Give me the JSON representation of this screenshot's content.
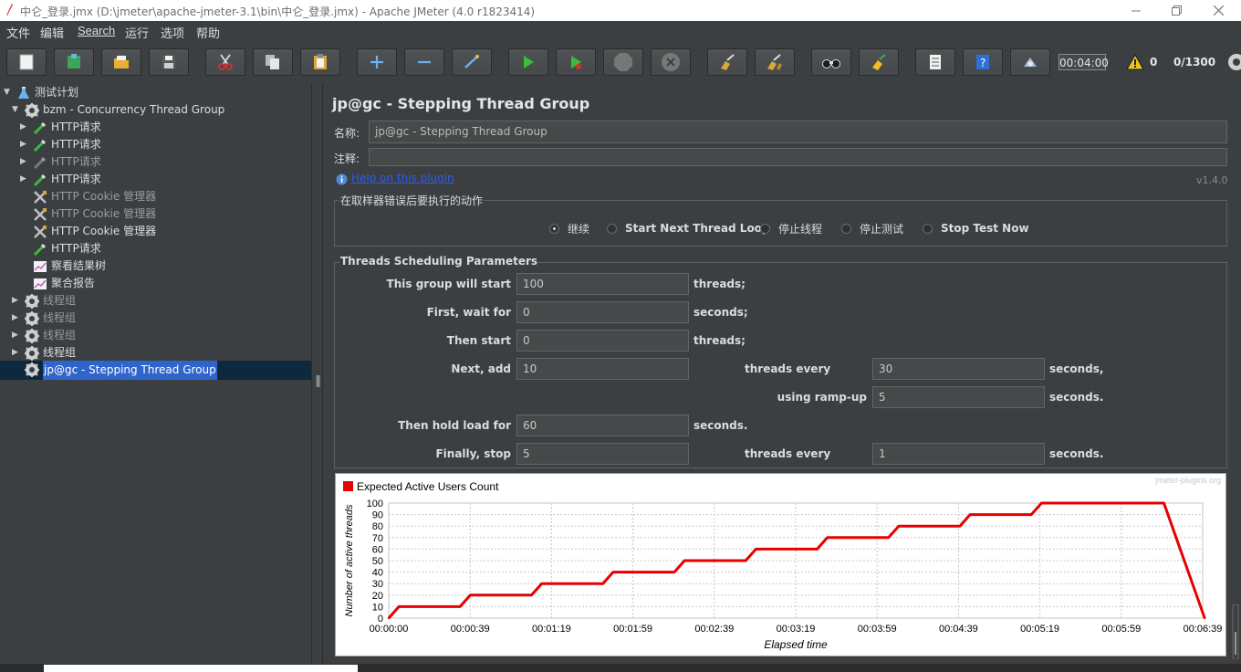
{
  "window": {
    "title": "中仑_登录.jmx (D:\\jmeter\\apache-jmeter-3.1\\bin\\中仑_登录.jmx) - Apache JMeter (4.0 r1823414)"
  },
  "menu": [
    "文件",
    "编辑",
    "Search",
    "运行",
    "选项",
    "帮助"
  ],
  "toolbar": {
    "timer": "00:04:00",
    "warnings": "0",
    "threads": "0/1300",
    "buttons": [
      "new-icon",
      "templates-icon",
      "open-icon",
      "save-icon",
      "cut-icon",
      "copy-icon",
      "paste-icon",
      "expand-icon",
      "collapse-icon",
      "toggle-icon",
      "start-icon",
      "start-no-pause-icon",
      "stop-icon",
      "shutdown-icon",
      "clear-icon",
      "clear-all-icon",
      "search-icon",
      "reset-search-icon",
      "function-helper-icon",
      "help-icon",
      "remote-icon"
    ]
  },
  "tree": {
    "items": [
      {
        "label": "测试计划"
      },
      {
        "label": "bzm - Concurrency Thread Group"
      },
      {
        "label": "HTTP请求"
      },
      {
        "label": "HTTP请求"
      },
      {
        "label": "HTTP请求"
      },
      {
        "label": "HTTP请求"
      },
      {
        "label": "HTTP Cookie 管理器"
      },
      {
        "label": "HTTP Cookie 管理器"
      },
      {
        "label": "HTTP Cookie 管理器"
      },
      {
        "label": "HTTP请求"
      },
      {
        "label": "察看结果树"
      },
      {
        "label": "聚合报告"
      },
      {
        "label": "线程组"
      },
      {
        "label": "线程组"
      },
      {
        "label": "线程组"
      },
      {
        "label": "线程组"
      },
      {
        "label": "jp@gc - Stepping Thread Group"
      }
    ]
  },
  "panel": {
    "title": "jp@gc - Stepping Thread Group",
    "name_label": "名称:",
    "name_value": "jp@gc - Stepping Thread Group",
    "comment_label": "注释:",
    "comment_value": "",
    "help_link": "Help on this plugin",
    "version": "v1.4.0",
    "error_group_title": "在取样器错误后要执行的动作",
    "error_options": [
      "继续",
      "Start Next Thread Loop",
      "停止线程",
      "停止测试",
      "Stop Test Now"
    ],
    "error_selected": "继续",
    "sched_title": "Threads Scheduling Parameters",
    "sched": {
      "start_label": "This group will start",
      "start_value": "100",
      "start_unit": "threads;",
      "wait_label": "First, wait for",
      "wait_value": "0",
      "wait_unit": "seconds;",
      "then_label": "Then start",
      "then_value": "0",
      "then_unit": "threads;",
      "next_label": "Next, add",
      "next_value": "10",
      "next_mid": "threads every",
      "next_value2": "30",
      "next_unit": "seconds,",
      "ramp_label": "using ramp-up",
      "ramp_value": "5",
      "ramp_unit": "seconds.",
      "hold_label": "Then hold load for",
      "hold_value": "60",
      "hold_unit": "seconds.",
      "stop_label": "Finally, stop",
      "stop_value": "5",
      "stop_mid": "threads every",
      "stop_value2": "1",
      "stop_unit": "seconds."
    }
  },
  "chart_data": {
    "type": "line",
    "legend": "Expected Active Users Count",
    "watermark": "jmeter-plugins.org",
    "xlabel": "Elapsed time",
    "ylabel": "Number of active threads",
    "xlim": [
      0,
      399
    ],
    "ylim": [
      0,
      100
    ],
    "xticks": [
      "00:00:00",
      "00:00:39",
      "00:01:19",
      "00:01:59",
      "00:02:39",
      "00:03:19",
      "00:03:59",
      "00:04:39",
      "00:05:19",
      "00:05:59",
      "00:06:39"
    ],
    "yticks": [
      "0",
      "10",
      "20",
      "30",
      "40",
      "50",
      "60",
      "70",
      "80",
      "90",
      "100"
    ],
    "color": "#e60000",
    "x": [
      0,
      5,
      35,
      40,
      70,
      75,
      105,
      110,
      140,
      145,
      175,
      180,
      210,
      215,
      245,
      250,
      280,
      285,
      315,
      320,
      380,
      400
    ],
    "y": [
      0,
      10,
      10,
      20,
      20,
      30,
      30,
      40,
      40,
      50,
      50,
      60,
      60,
      70,
      70,
      80,
      80,
      90,
      90,
      100,
      100,
      0
    ]
  }
}
